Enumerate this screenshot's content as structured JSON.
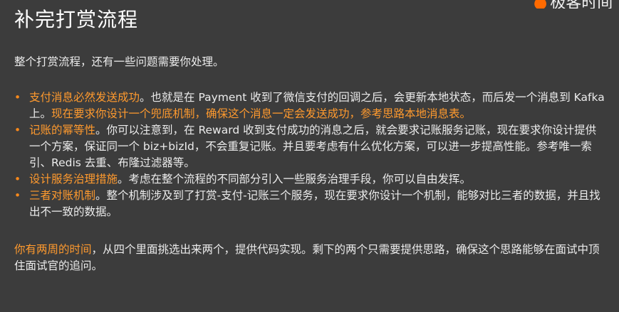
{
  "title": "补完打赏流程",
  "logo_text": "极客时间",
  "intro": "整个打赏流程，还有一些问题需要你处理。",
  "items": [
    {
      "head": "支付消息必然发送成功",
      "body": "。也就是在 Payment 收到了微信支付的回调之后，会更新本地状态，而后发一个消息到 Kafka 上。",
      "highlight": "现在要求你设计一个兜底机制，确保这个消息一定会发送成功，参考思路本地消息表。",
      "tail": ""
    },
    {
      "head": "记账的幂等性",
      "body": "。你可以注意到，在 Reward 收到支付成功的消息之后，就会要求记账服务记账，现在要求你设计提供一个方案，保证同一个 biz+bizId，不会重复记账。并且要考虑有什么优化方案，可以进一步提高性能。参考唯一索引、Redis 去重、布隆过滤器等。",
      "highlight": "",
      "tail": ""
    },
    {
      "head": "设计服务治理措施",
      "body": "。考虑在整个流程的不同部分引入一些服务治理手段，你可以自由发挥。",
      "highlight": "",
      "tail": ""
    },
    {
      "head": "三者对账机制",
      "body": "。整个机制涉及到了打赏-支付-记账三个服务，现在要求你设计一个机制，能够对比三者的数据，并且找出不一致的数据。",
      "highlight": "",
      "tail": ""
    }
  ],
  "footer": {
    "highlight": "你有两周的时间",
    "text": "，从四个里面挑选出来两个，提供代码实现。剩下的两个只需要提供思路，确保这个思路能够在面试中顶住面试官的追问。"
  }
}
